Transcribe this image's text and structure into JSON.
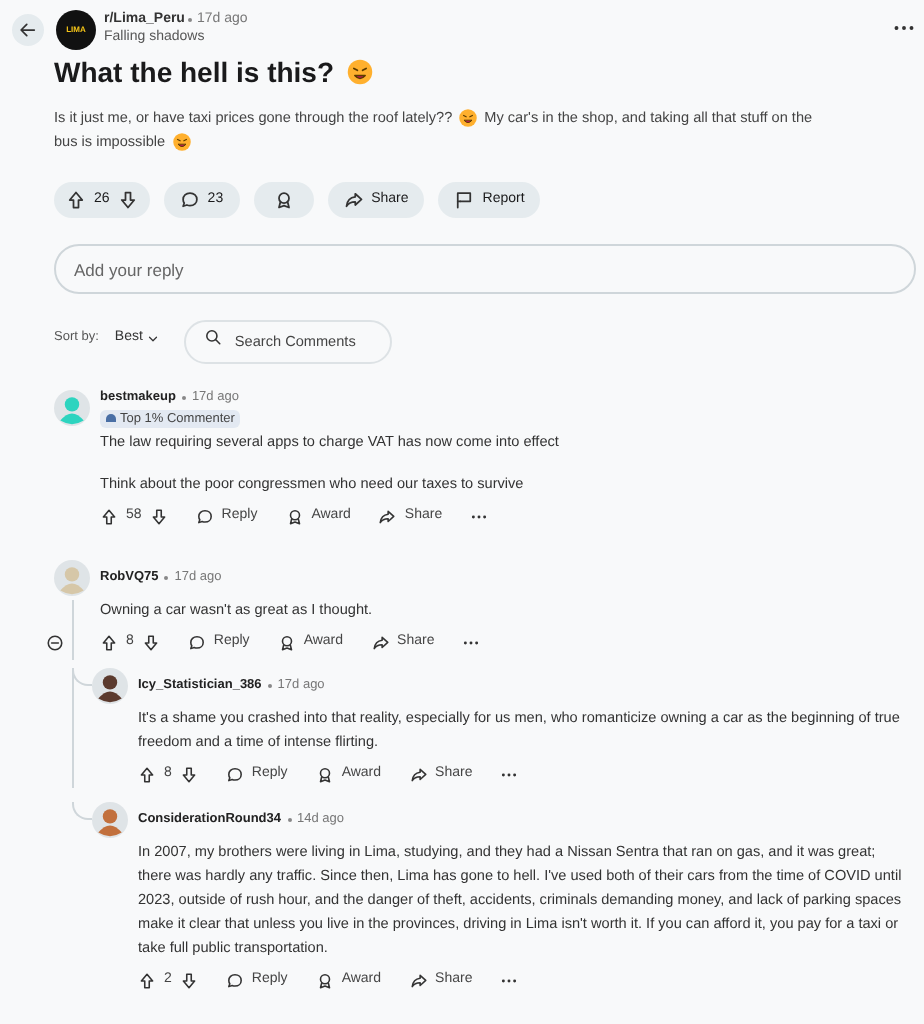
{
  "post": {
    "logo_text": "LIMA",
    "subreddit": "r/Lima_Peru",
    "time": "17d ago",
    "flair": "Falling shadows",
    "title": "What the hell is this?",
    "body": [
      [
        {
          "kind": "text",
          "text": "Is it just me, or have taxi prices gone through the roof lately??"
        },
        {
          "kind": "emoji"
        },
        {
          "kind": "text",
          "text": "My car's in the shop, and taking all that stuff on the"
        }
      ],
      [
        {
          "kind": "text",
          "text": "bus is impossible"
        },
        {
          "kind": "emoji"
        }
      ]
    ],
    "votes": "26",
    "comments": "23",
    "share": "Share",
    "report": "Report"
  },
  "reply_field": {
    "placeholder": "Add your reply"
  },
  "sort": {
    "label": "Sort by:",
    "value": "Best"
  },
  "search": {
    "placeholder": "Search Comments"
  },
  "comments": [
    {
      "author": "bestmakeup",
      "time": "17d ago",
      "badge": "Top 1% Commenter",
      "color": "#2dd4bf",
      "paragraphs": [
        "The law requiring several apps to charge VAT has now come into effect",
        "Think about the poor congressmen who need our taxes to survive"
      ],
      "votes": "58",
      "reply": "Reply",
      "award": "Award",
      "share": "Share"
    },
    {
      "author": "RobVQ75",
      "time": "17d ago",
      "color": "#d6c7a8",
      "paragraphs": [
        "Owning a car wasn't as great as I thought."
      ],
      "votes": "8",
      "reply": "Reply",
      "award": "Award",
      "share": "Share",
      "children": [
        {
          "author": "Icy_Statistician_386",
          "time": "17d ago",
          "color": "#5b3a2e",
          "paragraphs": [
            "It's a shame you crashed into that reality, especially for us men, who romanticize owning a car as the beginning of true freedom and a time of intense flirting."
          ],
          "votes": "8",
          "reply": "Reply",
          "award": "Award",
          "share": "Share"
        },
        {
          "author": "ConsiderationRound34",
          "time": "14d ago",
          "color": "#c2703d",
          "paragraphs": [
            "In 2007, my brothers were living in Lima, studying, and they had a Nissan Sentra that ran on gas, and it was great; there was hardly any traffic. Since then, Lima has gone to hell. I've used both of their cars from the time of COVID until 2023, outside of rush hour, and the danger of theft, accidents, criminals demanding money, and lack of parking spaces make it clear that unless you live in the provinces, driving in Lima isn't worth it. If you can afford it, you pay for a taxi or take full public transportation."
          ],
          "votes": "2",
          "reply": "Reply",
          "award": "Award",
          "share": "Share"
        }
      ]
    }
  ]
}
